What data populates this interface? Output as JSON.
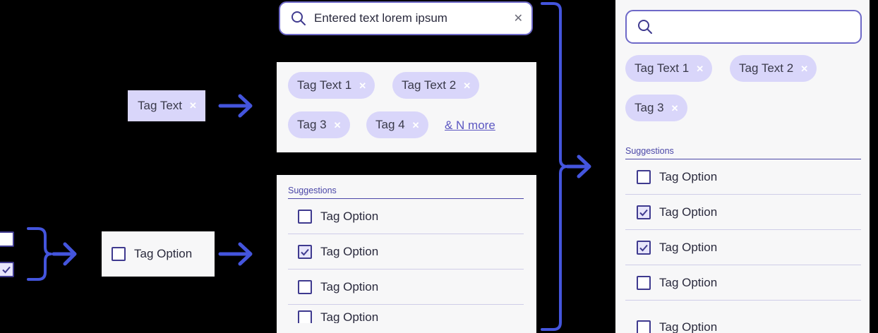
{
  "colors": {
    "background": "#000000",
    "panel": "#f7f7f8",
    "tag_fill": "#d9d6fa",
    "accent": "#4b47a8",
    "arrow": "#4455dd"
  },
  "search_active": {
    "icon": "search-icon",
    "value": "Entered text lorem ipsum",
    "clear_icon": "close-icon",
    "clear_glyph": "✕"
  },
  "single_tag": {
    "label": "Tag Text",
    "remove_glyph": "✕"
  },
  "tags_panel": {
    "tags": [
      {
        "label": "Tag Text 1",
        "remove_glyph": "✕"
      },
      {
        "label": "Tag Text 2",
        "remove_glyph": "✕"
      },
      {
        "label": "Tag 3",
        "remove_glyph": "✕"
      },
      {
        "label": "Tag 4",
        "remove_glyph": "✕"
      }
    ],
    "more_link": "& N more"
  },
  "single_option": {
    "label": "Tag Option",
    "checked": false
  },
  "suggestions_panel": {
    "heading": "Suggestions",
    "options": [
      {
        "label": "Tag Option",
        "checked": false
      },
      {
        "label": "Tag Option",
        "checked": true
      },
      {
        "label": "Tag Option",
        "checked": false
      },
      {
        "label": "Tag Option",
        "checked": false
      }
    ]
  },
  "combined": {
    "search_icon": "search-icon",
    "search_value": "",
    "tags": [
      {
        "label": "Tag Text 1",
        "remove_glyph": "✕"
      },
      {
        "label": "Tag Text 2",
        "remove_glyph": "✕"
      },
      {
        "label": "Tag 3",
        "remove_glyph": "✕"
      }
    ],
    "heading": "Suggestions",
    "options": [
      {
        "label": "Tag Option",
        "checked": false
      },
      {
        "label": "Tag Option",
        "checked": true
      },
      {
        "label": "Tag Option",
        "checked": true
      },
      {
        "label": "Tag Option",
        "checked": false
      },
      {
        "label": "Tag Option",
        "checked": false
      }
    ]
  }
}
